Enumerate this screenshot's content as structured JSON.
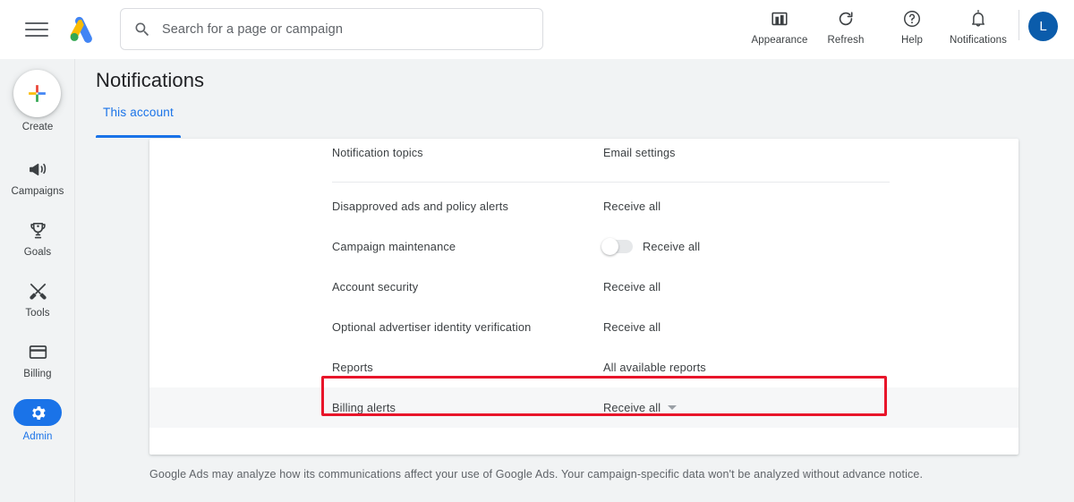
{
  "app": {
    "title": "Google Ads"
  },
  "topbar": {
    "menu_icon": "hamburger-menu-icon",
    "logo_icon": "google-ads-logo",
    "search": {
      "placeholder": "Search for a page or campaign",
      "value": "",
      "icon": "search-icon"
    },
    "actions": [
      {
        "label": "Appearance",
        "icon": "appearance-icon"
      },
      {
        "label": "Refresh",
        "icon": "refresh-icon"
      },
      {
        "label": "Help",
        "icon": "help-icon"
      },
      {
        "label": "Notifications",
        "icon": "bell-icon"
      }
    ],
    "avatar": {
      "initial": "L",
      "color": "#0b5cab"
    }
  },
  "sidebar": {
    "create": {
      "label": "Create",
      "icon": "plus-icon"
    },
    "items": [
      {
        "label": "Campaigns",
        "icon": "megaphone-icon",
        "active": false
      },
      {
        "label": "Goals",
        "icon": "trophy-icon",
        "active": false
      },
      {
        "label": "Tools",
        "icon": "tools-icon",
        "active": false
      },
      {
        "label": "Billing",
        "icon": "credit-card-icon",
        "active": false
      },
      {
        "label": "Admin",
        "icon": "gear-icon",
        "active": true
      }
    ],
    "active_color": "#1a73e8"
  },
  "main": {
    "page_title": "Notifications",
    "tabs": [
      {
        "label": "This account",
        "active": true
      }
    ],
    "table": {
      "columns": [
        "Notification topics",
        "Email settings"
      ],
      "rows": [
        {
          "topic": "Disapproved ads and policy alerts",
          "setting": "Receive all",
          "toggle": null,
          "caret": false,
          "highlighted": false
        },
        {
          "topic": "Campaign maintenance",
          "setting": "Receive all",
          "toggle": "off",
          "caret": false,
          "highlighted": false
        },
        {
          "topic": "Account security",
          "setting": "Receive all",
          "toggle": null,
          "caret": false,
          "highlighted": false
        },
        {
          "topic": "Optional advertiser identity verification",
          "setting": "Receive all",
          "toggle": null,
          "caret": false,
          "highlighted": false
        },
        {
          "topic": "Reports",
          "setting": "All available reports",
          "toggle": null,
          "caret": false,
          "highlighted": false
        },
        {
          "topic": "Billing alerts",
          "setting": "Receive all",
          "toggle": null,
          "caret": true,
          "highlighted": true
        }
      ]
    },
    "footnote": "Google Ads may analyze how its communications affect your use of Google Ads. Your campaign-specific data won't be analyzed without advance notice.",
    "highlight_color": "#e8152a"
  }
}
